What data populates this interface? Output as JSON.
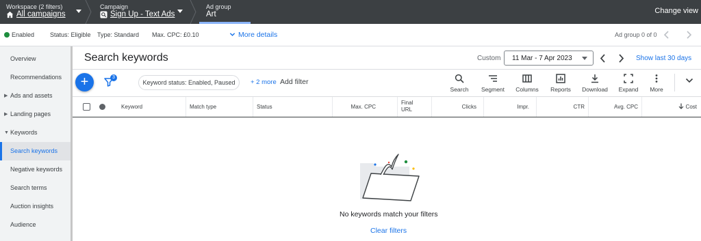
{
  "topbar": {
    "workspace_label": "Workspace (2 filters)",
    "workspace_value": "All campaigns",
    "campaign_label": "Campaign",
    "campaign_value": "Sign Up - Text Ads",
    "adgroup_label": "Ad group",
    "adgroup_value": "Art",
    "change_view": "Change view"
  },
  "status_row": {
    "enabled": "Enabled",
    "status": "Status: Eligible",
    "type": "Type: Standard",
    "max_cpc": "Max. CPC: £0.10",
    "more_details": "More details",
    "adgroup_count": "Ad group 0 of 0"
  },
  "sidebar": {
    "items": [
      {
        "label": "Overview"
      },
      {
        "label": "Recommendations"
      },
      {
        "label": "Ads and assets"
      },
      {
        "label": "Landing pages"
      },
      {
        "label": "Keywords"
      },
      {
        "label": "Search keywords"
      },
      {
        "label": "Negative keywords"
      },
      {
        "label": "Search terms"
      },
      {
        "label": "Auction insights"
      },
      {
        "label": "Audience"
      }
    ]
  },
  "main": {
    "title": "Search keywords",
    "custom_label": "Custom",
    "date_range": "11 Mar - 7 Apr 2023",
    "show_last": "Show last 30 days"
  },
  "toolbar": {
    "filter_badge": "3",
    "chip": "Keyword status: Enabled, Paused",
    "more_link": "+ 2 more",
    "add_filter": "Add filter",
    "tools": [
      {
        "label": "Search",
        "icon": "search-icon"
      },
      {
        "label": "Segment",
        "icon": "segment-icon"
      },
      {
        "label": "Columns",
        "icon": "columns-icon"
      },
      {
        "label": "Reports",
        "icon": "reports-icon"
      },
      {
        "label": "Download",
        "icon": "download-icon"
      },
      {
        "label": "Expand",
        "icon": "expand-icon"
      },
      {
        "label": "More",
        "icon": "more-vert-icon"
      }
    ]
  },
  "table": {
    "columns": {
      "keyword": "Keyword",
      "match_type": "Match type",
      "status": "Status",
      "max_cpc": "Max. CPC",
      "final_url_1": "Final",
      "final_url_2": "URL",
      "clicks": "Clicks",
      "impr": "Impr.",
      "ctr": "CTR",
      "avg_cpc": "Avg. CPC",
      "cost": "Cost"
    }
  },
  "empty_state": {
    "message": "No keywords match your filters",
    "clear_filters": "Clear filters"
  },
  "colors": {
    "topbar_bg": "#3c4043",
    "accent": "#1a73e8",
    "enabled_green": "#1e8e3e"
  }
}
